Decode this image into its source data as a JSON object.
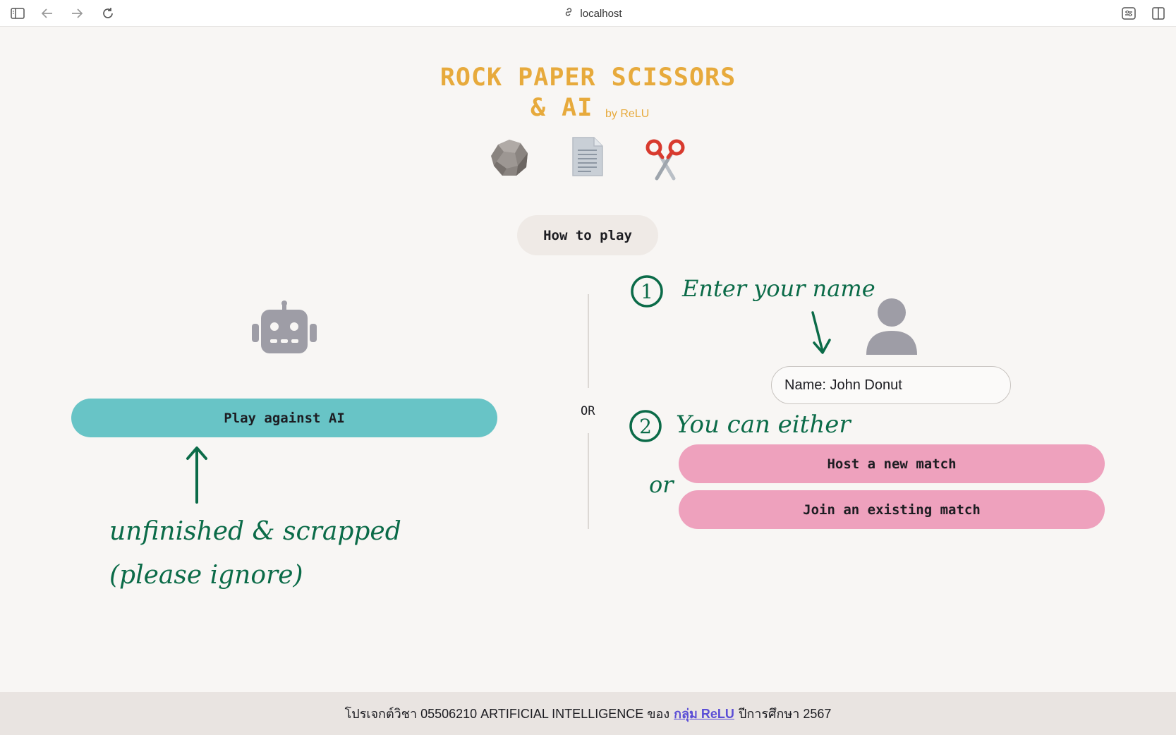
{
  "browser": {
    "url": "localhost"
  },
  "title": {
    "line1": "ROCK PAPER SCISSORS",
    "line2": "& AI",
    "byline": "by ReLU"
  },
  "how_to_play": "How to play",
  "left": {
    "play_ai": "Play against AI"
  },
  "divider": {
    "or": "OR"
  },
  "right": {
    "name_value": "Name: John Donut",
    "host": "Host a new match",
    "join": "Join an existing match"
  },
  "annotations": {
    "step1_num": "1",
    "step1": "Enter your name",
    "step2_num": "2",
    "step2": "You can either",
    "or": "or",
    "unfinished": "unfinished & scrapped",
    "ignore": "(please ignore)"
  },
  "footer": {
    "prefix": "โปรเจกต์วิชา 05506210 ARTIFICIAL INTELLIGENCE ของ",
    "link": "กลุ่ม ReLU",
    "suffix": "ปีการศึกษา 2567"
  },
  "colors": {
    "title": "#e7aa3c",
    "ai_button": "#68c4c6",
    "match_buttons": "#eea1bd",
    "annotation": "#0b6b48",
    "link": "#5b4ed6"
  }
}
